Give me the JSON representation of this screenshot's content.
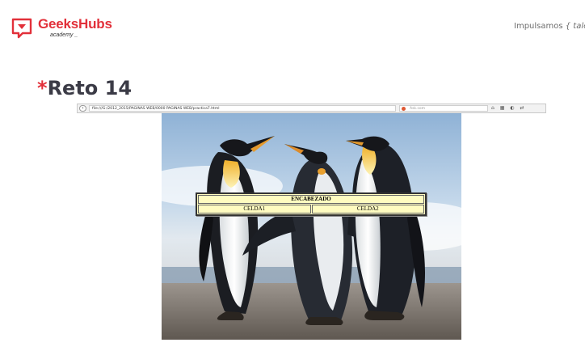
{
  "logo": {
    "name": "GeeksHubs",
    "sub": "academy _",
    "color": "#e2303a"
  },
  "header": {
    "tagline_prefix": "Impulsamos ",
    "tagline_brace": "{ talent"
  },
  "slide": {
    "star": "*",
    "title": "Reto 14",
    "title_color": "#3b3b46",
    "accent": "#e2303a"
  },
  "browser": {
    "url": "file:///G:/2012_2015/PAGINAS WEB/0000 PAGINAS WEB/practica7.html",
    "search_placeholder": "Ask.com",
    "icons": [
      "home-icon",
      "bookmarks-icon",
      "addons-icon",
      "sync-icon"
    ]
  },
  "page_table": {
    "header": "ENCABEZADO",
    "cells": [
      "CELDA1",
      "CELDA2"
    ],
    "background": "#fffcc0"
  }
}
